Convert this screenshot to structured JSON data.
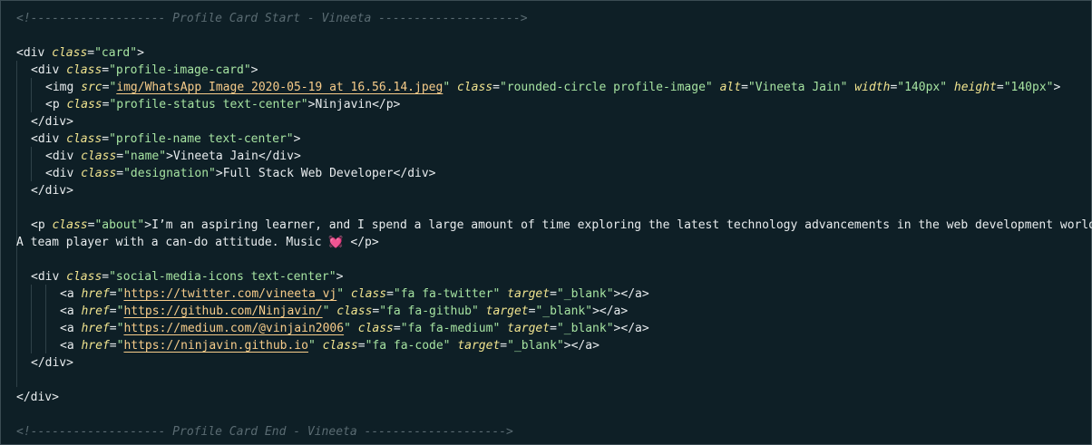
{
  "editor": {
    "lines": [
      {
        "kind": "comment",
        "text": "<!------------------- Profile Card Start - Vineeta -------------------->"
      },
      {
        "kind": "blank"
      },
      {
        "kind": "code",
        "indent": 0,
        "segs": [
          [
            "br",
            "<"
          ],
          [
            "tag",
            "div"
          ],
          [
            "sp",
            " "
          ],
          [
            "attr",
            "class"
          ],
          [
            "eq",
            "="
          ],
          [
            "str",
            "\"card\""
          ],
          [
            "br",
            ">"
          ]
        ]
      },
      {
        "kind": "code",
        "indent": 1,
        "segs": [
          [
            "br",
            "<"
          ],
          [
            "tag",
            "div"
          ],
          [
            "sp",
            " "
          ],
          [
            "attr",
            "class"
          ],
          [
            "eq",
            "="
          ],
          [
            "str",
            "\"profile-image-card\""
          ],
          [
            "br",
            ">"
          ]
        ]
      },
      {
        "kind": "code",
        "indent": 2,
        "segs": [
          [
            "br",
            "<"
          ],
          [
            "tag",
            "img"
          ],
          [
            "sp",
            " "
          ],
          [
            "attr",
            "src"
          ],
          [
            "eq",
            "="
          ],
          [
            "str",
            "\""
          ],
          [
            "url",
            "img/WhatsApp Image 2020-05-19 at 16.56.14.jpeg"
          ],
          [
            "str",
            "\""
          ],
          [
            "sp",
            " "
          ],
          [
            "attr",
            "class"
          ],
          [
            "eq",
            "="
          ],
          [
            "str",
            "\"rounded-circle profile-image\""
          ],
          [
            "sp",
            " "
          ],
          [
            "attr",
            "alt"
          ],
          [
            "eq",
            "="
          ],
          [
            "str",
            "\"Vineeta Jain\""
          ],
          [
            "sp",
            " "
          ],
          [
            "attr",
            "width"
          ],
          [
            "eq",
            "="
          ],
          [
            "str",
            "\"140px\""
          ],
          [
            "sp",
            " "
          ],
          [
            "attr",
            "height"
          ],
          [
            "eq",
            "="
          ],
          [
            "str",
            "\"140px\""
          ],
          [
            "br",
            ">"
          ]
        ]
      },
      {
        "kind": "code",
        "indent": 2,
        "segs": [
          [
            "br",
            "<"
          ],
          [
            "tag",
            "p"
          ],
          [
            "sp",
            " "
          ],
          [
            "attr",
            "class"
          ],
          [
            "eq",
            "="
          ],
          [
            "str",
            "\"profile-status text-center\""
          ],
          [
            "br",
            ">"
          ],
          [
            "txt",
            "Ninjavin"
          ],
          [
            "br",
            "</"
          ],
          [
            "tag",
            "p"
          ],
          [
            "br",
            ">"
          ]
        ]
      },
      {
        "kind": "code",
        "indent": 1,
        "segs": [
          [
            "br",
            "</"
          ],
          [
            "tag",
            "div"
          ],
          [
            "br",
            ">"
          ]
        ]
      },
      {
        "kind": "code",
        "indent": 1,
        "segs": [
          [
            "br",
            "<"
          ],
          [
            "tag",
            "div"
          ],
          [
            "sp",
            " "
          ],
          [
            "attr",
            "class"
          ],
          [
            "eq",
            "="
          ],
          [
            "str",
            "\"profile-name text-center\""
          ],
          [
            "br",
            ">"
          ]
        ]
      },
      {
        "kind": "code",
        "indent": 2,
        "segs": [
          [
            "br",
            "<"
          ],
          [
            "tag",
            "div"
          ],
          [
            "sp",
            " "
          ],
          [
            "attr",
            "class"
          ],
          [
            "eq",
            "="
          ],
          [
            "str",
            "\"name\""
          ],
          [
            "br",
            ">"
          ],
          [
            "txt",
            "Vineeta Jain"
          ],
          [
            "br",
            "</"
          ],
          [
            "tag",
            "div"
          ],
          [
            "br",
            ">"
          ]
        ]
      },
      {
        "kind": "code",
        "indent": 2,
        "segs": [
          [
            "br",
            "<"
          ],
          [
            "tag",
            "div"
          ],
          [
            "sp",
            " "
          ],
          [
            "attr",
            "class"
          ],
          [
            "eq",
            "="
          ],
          [
            "str",
            "\"designation\""
          ],
          [
            "br",
            ">"
          ],
          [
            "txt",
            "Full Stack Web Developer"
          ],
          [
            "br",
            "</"
          ],
          [
            "tag",
            "div"
          ],
          [
            "br",
            ">"
          ]
        ]
      },
      {
        "kind": "code",
        "indent": 1,
        "segs": [
          [
            "br",
            "</"
          ],
          [
            "tag",
            "div"
          ],
          [
            "br",
            ">"
          ]
        ]
      },
      {
        "kind": "blank"
      },
      {
        "kind": "code",
        "indent": 1,
        "segs": [
          [
            "br",
            "<"
          ],
          [
            "tag",
            "p"
          ],
          [
            "sp",
            " "
          ],
          [
            "attr",
            "class"
          ],
          [
            "eq",
            "="
          ],
          [
            "str",
            "\"about\""
          ],
          [
            "br",
            ">"
          ],
          [
            "txt",
            "I’m an aspiring learner, and I spend a large amount of time exploring the latest technology advancements in the web development world."
          ]
        ]
      },
      {
        "kind": "code",
        "indent": 0,
        "segs": [
          [
            "txt",
            "A team player with a can-do attitude. Music "
          ],
          [
            "heart",
            "💓"
          ],
          [
            "txt",
            " "
          ],
          [
            "br",
            "</"
          ],
          [
            "tag",
            "p"
          ],
          [
            "br",
            ">"
          ]
        ]
      },
      {
        "kind": "blank"
      },
      {
        "kind": "code",
        "indent": 1,
        "segs": [
          [
            "br",
            "<"
          ],
          [
            "tag",
            "div"
          ],
          [
            "sp",
            " "
          ],
          [
            "attr",
            "class"
          ],
          [
            "eq",
            "="
          ],
          [
            "str",
            "\"social-media-icons text-center\""
          ],
          [
            "br",
            ">"
          ]
        ]
      },
      {
        "kind": "code",
        "indent": 3,
        "segs": [
          [
            "br",
            "<"
          ],
          [
            "tag",
            "a"
          ],
          [
            "sp",
            " "
          ],
          [
            "attr",
            "href"
          ],
          [
            "eq",
            "="
          ],
          [
            "str",
            "\""
          ],
          [
            "url",
            "https://twitter.com/vineeta_vj"
          ],
          [
            "str",
            "\""
          ],
          [
            "sp",
            " "
          ],
          [
            "attr",
            "class"
          ],
          [
            "eq",
            "="
          ],
          [
            "str",
            "\"fa fa-twitter\""
          ],
          [
            "sp",
            " "
          ],
          [
            "attr",
            "target"
          ],
          [
            "eq",
            "="
          ],
          [
            "str",
            "\"_blank\""
          ],
          [
            "br",
            "></"
          ],
          [
            "tag",
            "a"
          ],
          [
            "br",
            ">"
          ]
        ]
      },
      {
        "kind": "code",
        "indent": 3,
        "segs": [
          [
            "br",
            "<"
          ],
          [
            "tag",
            "a"
          ],
          [
            "sp",
            " "
          ],
          [
            "attr",
            "href"
          ],
          [
            "eq",
            "="
          ],
          [
            "str",
            "\""
          ],
          [
            "url",
            "https://github.com/Ninjavin/"
          ],
          [
            "str",
            "\""
          ],
          [
            "sp",
            " "
          ],
          [
            "attr",
            "class"
          ],
          [
            "eq",
            "="
          ],
          [
            "str",
            "\"fa fa-github\""
          ],
          [
            "sp",
            " "
          ],
          [
            "attr",
            "target"
          ],
          [
            "eq",
            "="
          ],
          [
            "str",
            "\"_blank\""
          ],
          [
            "br",
            "></"
          ],
          [
            "tag",
            "a"
          ],
          [
            "br",
            ">"
          ]
        ]
      },
      {
        "kind": "code",
        "indent": 3,
        "segs": [
          [
            "br",
            "<"
          ],
          [
            "tag",
            "a"
          ],
          [
            "sp",
            " "
          ],
          [
            "attr",
            "href"
          ],
          [
            "eq",
            "="
          ],
          [
            "str",
            "\""
          ],
          [
            "url",
            "https://medium.com/@vinjain2006"
          ],
          [
            "str",
            "\""
          ],
          [
            "sp",
            " "
          ],
          [
            "attr",
            "class"
          ],
          [
            "eq",
            "="
          ],
          [
            "str",
            "\"fa fa-medium\""
          ],
          [
            "sp",
            " "
          ],
          [
            "attr",
            "target"
          ],
          [
            "eq",
            "="
          ],
          [
            "str",
            "\"_blank\""
          ],
          [
            "br",
            "></"
          ],
          [
            "tag",
            "a"
          ],
          [
            "br",
            ">"
          ]
        ]
      },
      {
        "kind": "code",
        "indent": 3,
        "segs": [
          [
            "br",
            "<"
          ],
          [
            "tag",
            "a"
          ],
          [
            "sp",
            " "
          ],
          [
            "attr",
            "href"
          ],
          [
            "eq",
            "="
          ],
          [
            "str",
            "\""
          ],
          [
            "url",
            "https://ninjavin.github.io"
          ],
          [
            "str",
            "\""
          ],
          [
            "sp",
            " "
          ],
          [
            "attr",
            "class"
          ],
          [
            "eq",
            "="
          ],
          [
            "str",
            "\"fa fa-code\""
          ],
          [
            "sp",
            " "
          ],
          [
            "attr",
            "target"
          ],
          [
            "eq",
            "="
          ],
          [
            "str",
            "\"_blank\""
          ],
          [
            "br",
            "></"
          ],
          [
            "tag",
            "a"
          ],
          [
            "br",
            ">"
          ]
        ]
      },
      {
        "kind": "code",
        "indent": 1,
        "segs": [
          [
            "br",
            "</"
          ],
          [
            "tag",
            "div"
          ],
          [
            "br",
            ">"
          ]
        ]
      },
      {
        "kind": "blank"
      },
      {
        "kind": "code",
        "indent": 0,
        "segs": [
          [
            "br",
            "</"
          ],
          [
            "tag",
            "div"
          ],
          [
            "br",
            ">"
          ]
        ]
      },
      {
        "kind": "blank"
      },
      {
        "kind": "comment",
        "text": "<!------------------- Profile Card End - Vineeta -------------------->"
      }
    ]
  },
  "colors": {
    "background": "#0e1f26",
    "attribute": "#f1e48f",
    "string": "#a6e3a1",
    "url": "#f7cc8a",
    "comment": "#5a6b72",
    "heart": "#e0455d"
  }
}
